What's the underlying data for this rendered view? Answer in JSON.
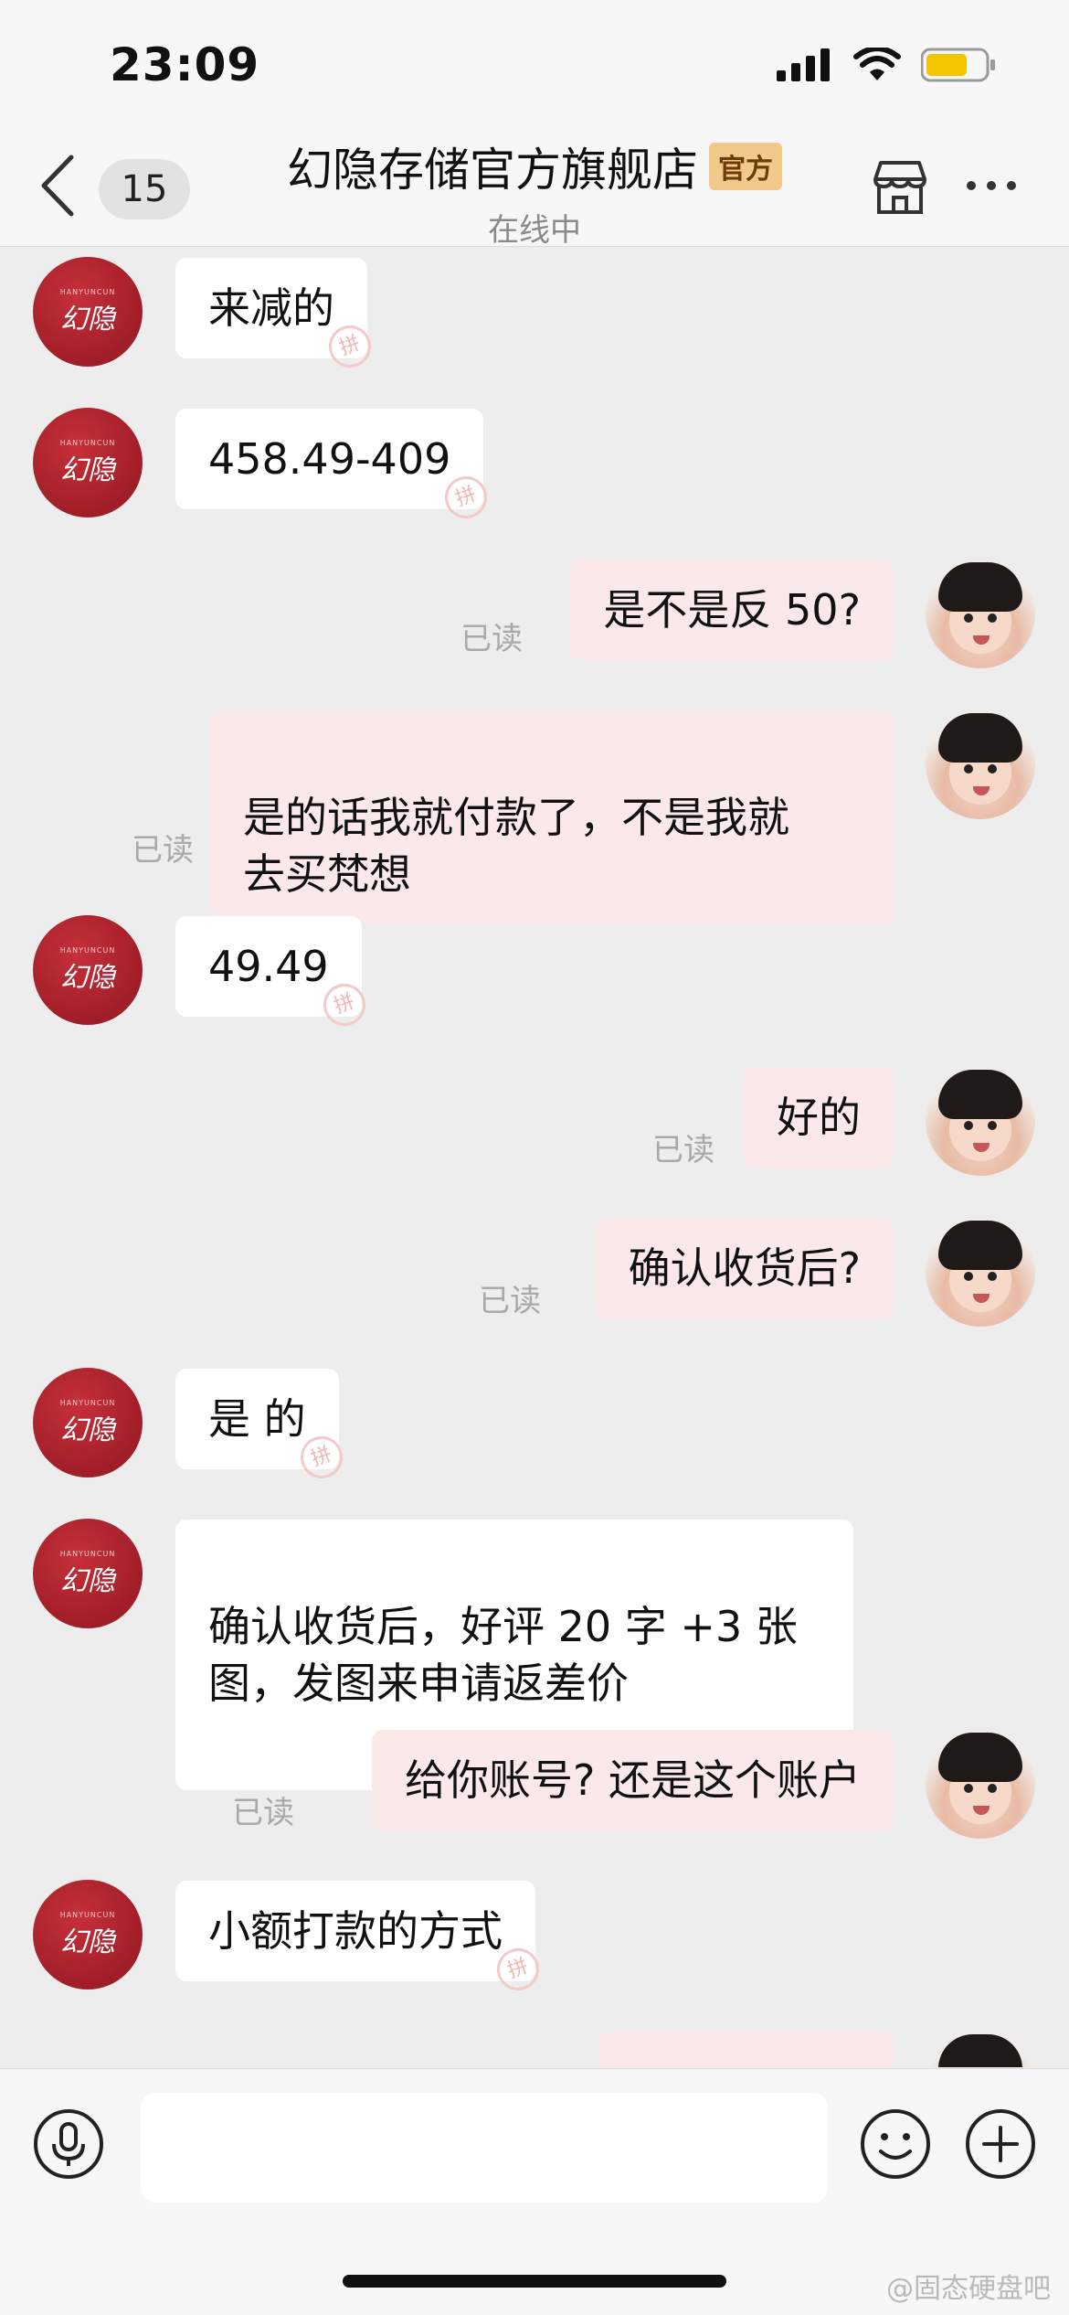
{
  "status": {
    "time": "23:09",
    "battery_color": "#f5c400"
  },
  "header": {
    "unread_count": "15",
    "shop_name": "幻隐存储官方旗舰店",
    "official_tag": "官方",
    "online_status": "在线中"
  },
  "seller": {
    "logo_text": "幻隐",
    "logo_small": "HANYUNCUN"
  },
  "messages": [
    {
      "from": "seller",
      "text": "来减的"
    },
    {
      "from": "seller",
      "text": "458.49-409"
    },
    {
      "from": "me",
      "text": "是不是反 50?",
      "read": "已读"
    },
    {
      "from": "me",
      "text": "是的话我就付款了，不是我就\n去买梵想",
      "read": "已读"
    },
    {
      "from": "seller",
      "text": "49.49"
    },
    {
      "from": "me",
      "text": "好的",
      "read": "已读"
    },
    {
      "from": "me",
      "text": "确认收货后?",
      "read": "已读"
    },
    {
      "from": "seller",
      "text": "是 的"
    },
    {
      "from": "seller",
      "text": "确认收货后，好评 20 字 +3 张\n图，发图来申请返差价"
    },
    {
      "from": "me",
      "text": "给你账号? 还是这个账户",
      "read": "已读"
    },
    {
      "from": "seller",
      "text": "小额打款的方式"
    }
  ],
  "input": {
    "placeholder": ""
  },
  "watermark": "@固态硬盘吧"
}
